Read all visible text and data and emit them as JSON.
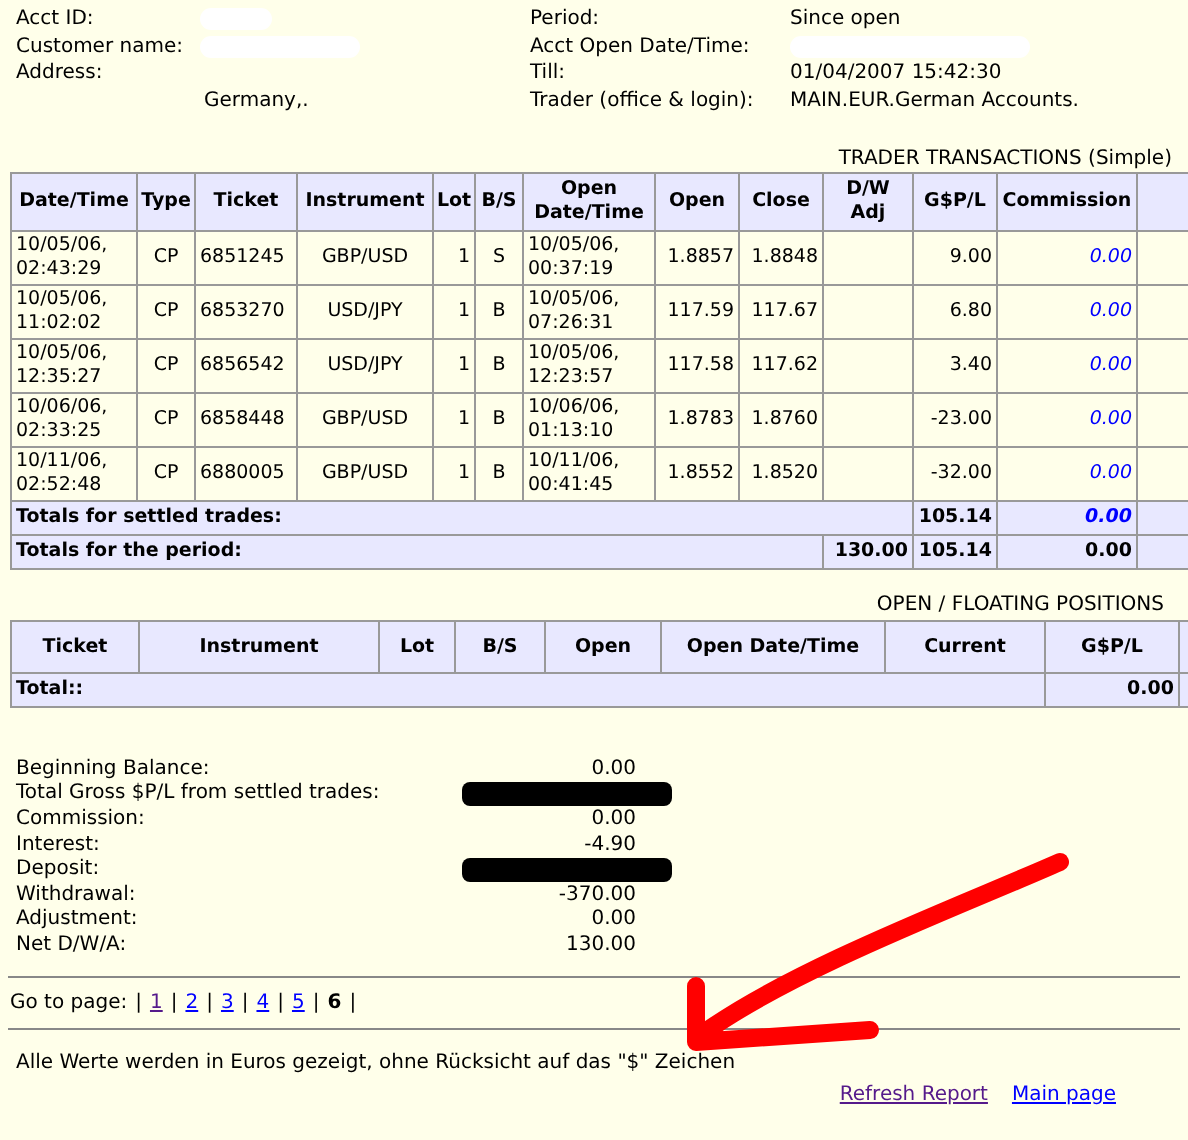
{
  "account": {
    "left": [
      {
        "label": "Acct ID:",
        "redacted": true
      },
      {
        "label": "Customer name:",
        "redacted": true
      },
      {
        "label": "Address:",
        "redacted": false
      }
    ],
    "address_line": "Germany,.",
    "right": [
      {
        "label": "Period:",
        "value": "Since open",
        "redacted": false
      },
      {
        "label": "Acct Open Date/Time:",
        "redacted": true
      },
      {
        "label": "Till:",
        "value": "01/04/2007 15:42:30",
        "redacted": false
      },
      {
        "label": "Trader (office & login):",
        "value": "MAIN.EUR.German Accounts.",
        "redacted": false
      }
    ]
  },
  "transactions": {
    "title": "TRADER TRANSACTIONS (Simple)",
    "columns": [
      {
        "label": "Date/Time",
        "kind": "left"
      },
      {
        "label": "Type",
        "kind": "center"
      },
      {
        "label": "Ticket",
        "kind": "left"
      },
      {
        "label": "Instrument",
        "kind": "center"
      },
      {
        "label": "Lot",
        "kind": "right"
      },
      {
        "label": "B/S",
        "kind": "center"
      },
      {
        "label": "Open Date/Time",
        "kind": "left"
      },
      {
        "label": "Open",
        "kind": "right"
      },
      {
        "label": "Close",
        "kind": "right"
      },
      {
        "label": "D/W Adj",
        "kind": "right"
      },
      {
        "label": "G$P/L",
        "kind": "right"
      },
      {
        "label": "Commission",
        "kind": "link"
      }
    ],
    "rows": [
      [
        "10/05/06, 02:43:29",
        "CP",
        "6851245",
        "GBP/USD",
        "1",
        "S",
        "10/05/06, 00:37:19",
        "1.8857",
        "1.8848",
        "",
        "9.00",
        "0.00"
      ],
      [
        "10/05/06, 11:02:02",
        "CP",
        "6853270",
        "USD/JPY",
        "1",
        "B",
        "10/05/06, 07:26:31",
        "117.59",
        "117.67",
        "",
        "6.80",
        "0.00"
      ],
      [
        "10/05/06, 12:35:27",
        "CP",
        "6856542",
        "USD/JPY",
        "1",
        "B",
        "10/05/06, 12:23:57",
        "117.58",
        "117.62",
        "",
        "3.40",
        "0.00"
      ],
      [
        "10/06/06, 02:33:25",
        "CP",
        "6858448",
        "GBP/USD",
        "1",
        "B",
        "10/06/06, 01:13:10",
        "1.8783",
        "1.8760",
        "",
        "-23.00",
        "0.00"
      ],
      [
        "10/11/06, 02:52:48",
        "CP",
        "6880005",
        "GBP/USD",
        "1",
        "B",
        "10/11/06, 00:41:45",
        "1.8552",
        "1.8520",
        "",
        "-32.00",
        "0.00"
      ]
    ],
    "totals": [
      {
        "label": "Totals for settled trades:",
        "gpl": "105.14",
        "commission": "0.00",
        "highlighted": true
      },
      {
        "label": "Totals for the period:",
        "dw_adj": "130.00",
        "gpl": "105.14",
        "commission": "0.00",
        "highlighted": false
      }
    ]
  },
  "positions": {
    "title": "OPEN / FLOATING POSITIONS",
    "columns": [
      "Ticket",
      "Instrument",
      "Lot",
      "B/S",
      "Open",
      "Open Date/Time",
      "Current",
      "G$P/L"
    ],
    "total": {
      "label": "Total::",
      "gpl": "0.00"
    }
  },
  "summary": [
    {
      "label": "Beginning Balance:",
      "value": "0.00",
      "redacted": false
    },
    {
      "label": "Total Gross $P/L from settled trades:",
      "redacted": true
    },
    {
      "label": "Commission:",
      "value": "0.00",
      "redacted": false
    },
    {
      "label": "Interest:",
      "value": "-4.90",
      "redacted": false
    },
    {
      "label": "Deposit:",
      "redacted": true
    },
    {
      "label": "Withdrawal:",
      "value": "-370.00",
      "redacted": false
    },
    {
      "label": "Adjustment:",
      "value": "0.00",
      "redacted": false
    },
    {
      "label": "Net D/W/A:",
      "value": "130.00",
      "redacted": false
    }
  ],
  "pager": {
    "label": "Go to page:",
    "separator": "|",
    "pages": [
      {
        "label": "1",
        "selected": false,
        "visited": true
      },
      {
        "label": "2",
        "selected": false,
        "visited": false
      },
      {
        "label": "3",
        "selected": false,
        "visited": false
      },
      {
        "label": "4",
        "selected": false,
        "visited": false
      },
      {
        "label": "5",
        "selected": false,
        "visited": false
      },
      {
        "label": "6",
        "selected": true,
        "visited": false
      }
    ]
  },
  "note": "Alle Werte werden in Euros gezeigt, ohne Rücksicht auf das \"$\" Zeichen",
  "links": [
    {
      "label": "Refresh Report",
      "visited": true
    },
    {
      "label": "Main page",
      "visited": false
    }
  ]
}
